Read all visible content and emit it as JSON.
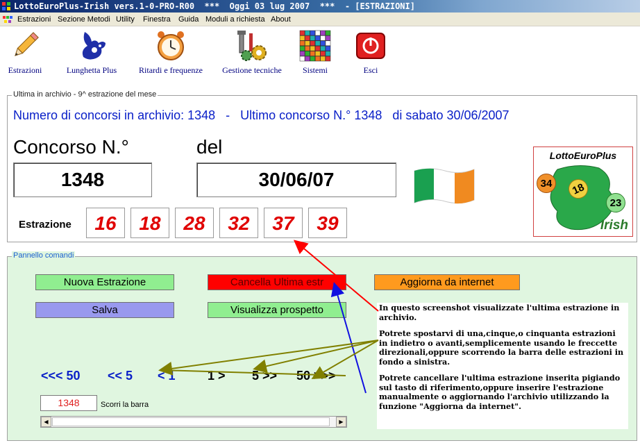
{
  "window": {
    "title": "LottoEuroPlus-Irish vers.1-0-PRO-R00  ***  Oggi 03 lug 2007  ***  - [ESTRAZIONI]"
  },
  "menu": [
    "Estrazioni",
    "Sezione Metodi",
    "Utility",
    "Finestra",
    "Guida",
    "Moduli a richiesta",
    "About"
  ],
  "toolbar": {
    "estrazioni": "Estrazioni",
    "lunghetta": "Lunghetta Plus",
    "ritardi": "Ritardi e frequenze",
    "gestione": "Gestione tecniche",
    "sistemi": "Sistemi",
    "esci": "Esci"
  },
  "archive": {
    "legend": "Ultima in archivio - 9^ estrazione del mese",
    "info": "Numero di concorsi in archivio: 1348   -   Ultimo concorso N.° 1348   di sabato 30/06/2007",
    "concorso_label": "Concorso N.°",
    "del_label": "del",
    "concorso_value": "1348",
    "date_value": "30/06/07",
    "estrazione_label": "Estrazione",
    "numbers": [
      "16",
      "18",
      "28",
      "32",
      "37",
      "39"
    ],
    "logo": {
      "title": "LottoEuroPlus",
      "subtitle": "Irish",
      "balls": [
        "34",
        "18",
        "23"
      ]
    }
  },
  "commands": {
    "legend": "Pannello comandi",
    "nuova": "Nuova Estrazione",
    "cancella": "Cancella Ultima estr",
    "aggiorna": "Aggiorna da internet",
    "salva": "Salva",
    "visualizza": "Visualizza prospetto",
    "nav": {
      "back50": "<<< 50",
      "back5": "<< 5",
      "back1": "< 1",
      "fwd1": "1 >",
      "fwd5": "5 >>",
      "fwd50": "50 >>>"
    },
    "counter": "1348",
    "scroll_label": "Scorri la barra"
  },
  "annotation": {
    "p1": "In questo screenshot visualizzate l'ultima estrazione in archivio.",
    "p2": "Potrete spostarvi di una,cinque,o cinquanta estrazioni in indietro o avanti,semplicemente usando le freccette direzionali,oppure scorrendo la barra delle estrazioni in fondo a sinistra.",
    "p3": "Potrete cancellare l'ultima estrazione inserita pigiando sul tasto di riferimento,oppure inserire l'estrazione manualmente o aggiornando l'archivio utilizzando la funzione \"Aggiorna da internet\"."
  },
  "colors": {
    "accent_blue": "#0a20c8",
    "number_red": "#e00000",
    "panel_green": "#e0f6e0",
    "button_green": "#90ee90",
    "button_red": "#ff0000",
    "button_orange": "#ff9a1e",
    "button_violet": "#9999ee",
    "arrow_red": "#ff0000",
    "arrow_blue": "#1010e0",
    "arrow_olive": "#808000"
  },
  "icons": [
    "app-icon",
    "pencil-icon",
    "rabbit-logo-icon",
    "alarm-clock-icon",
    "tools-gears-icon",
    "grid-icon",
    "exit-power-icon",
    "irish-flag-icon"
  ]
}
